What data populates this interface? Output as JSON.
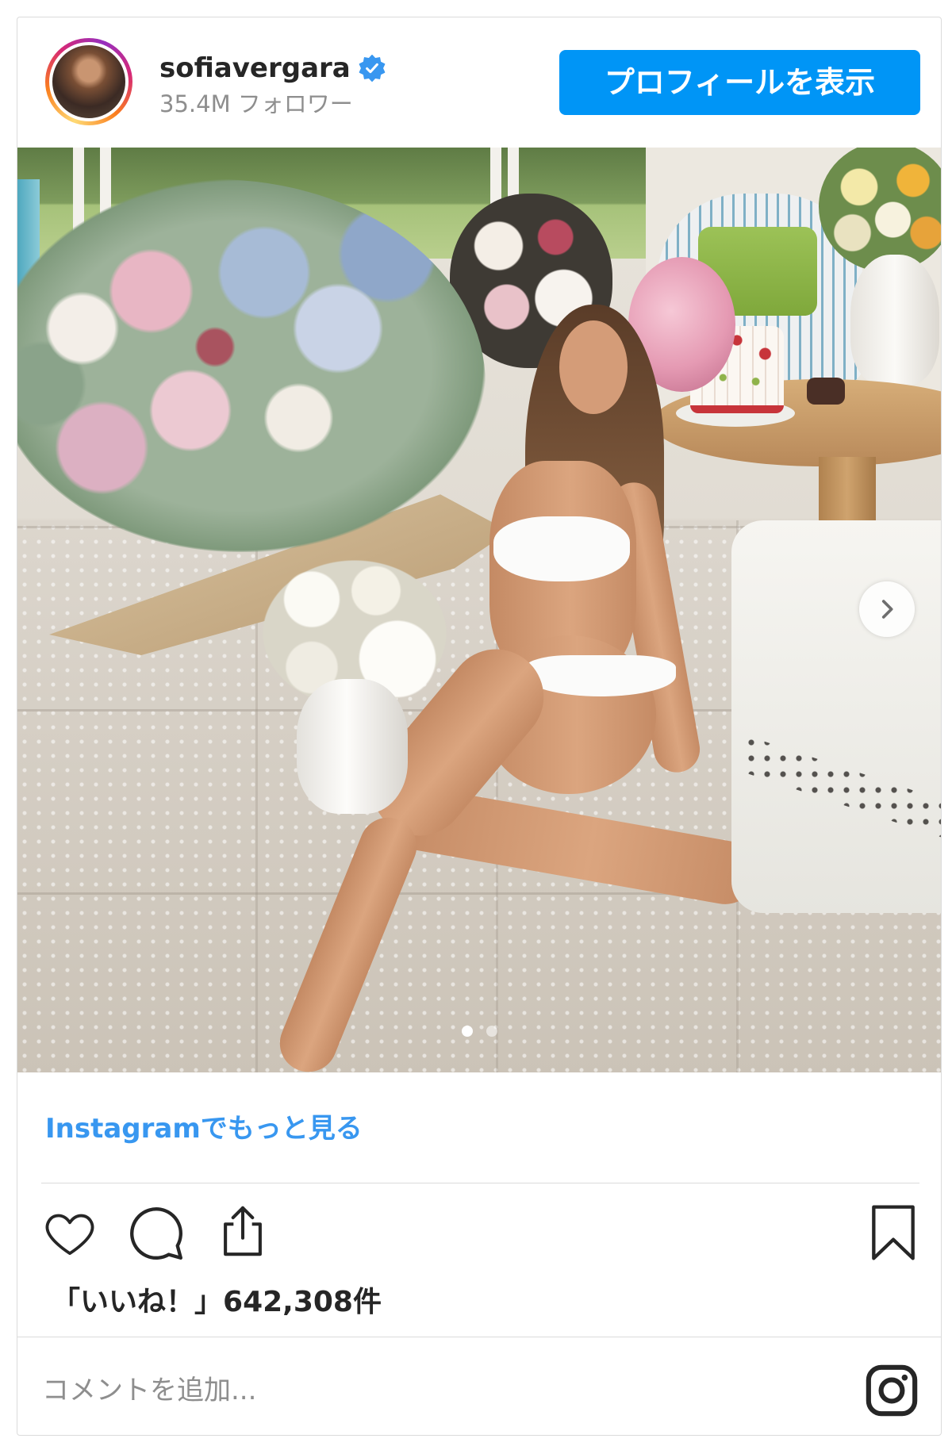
{
  "header": {
    "username": "sofiavergara",
    "verified": true,
    "followers": "35.4M フォロワー",
    "profile_button": "プロフィールを表示"
  },
  "carousel": {
    "slide_count": 2,
    "active_index": 0
  },
  "footer": {
    "more_link": "Instagramでもっと見る",
    "likes_label": "「いいね！」",
    "likes_count": "642,308件",
    "comment_placeholder": "コメントを追加..."
  },
  "icons": {
    "verified": "verified-badge-icon",
    "next": "chevron-right-icon",
    "like": "heart-icon",
    "comment": "comment-icon",
    "share": "share-icon",
    "save": "bookmark-icon",
    "brand": "instagram-icon"
  },
  "colors": {
    "accent": "#0095f6",
    "link": "#3897f0",
    "text": "#262626",
    "muted": "#8e8e8e",
    "divider": "#dbdbdb"
  }
}
